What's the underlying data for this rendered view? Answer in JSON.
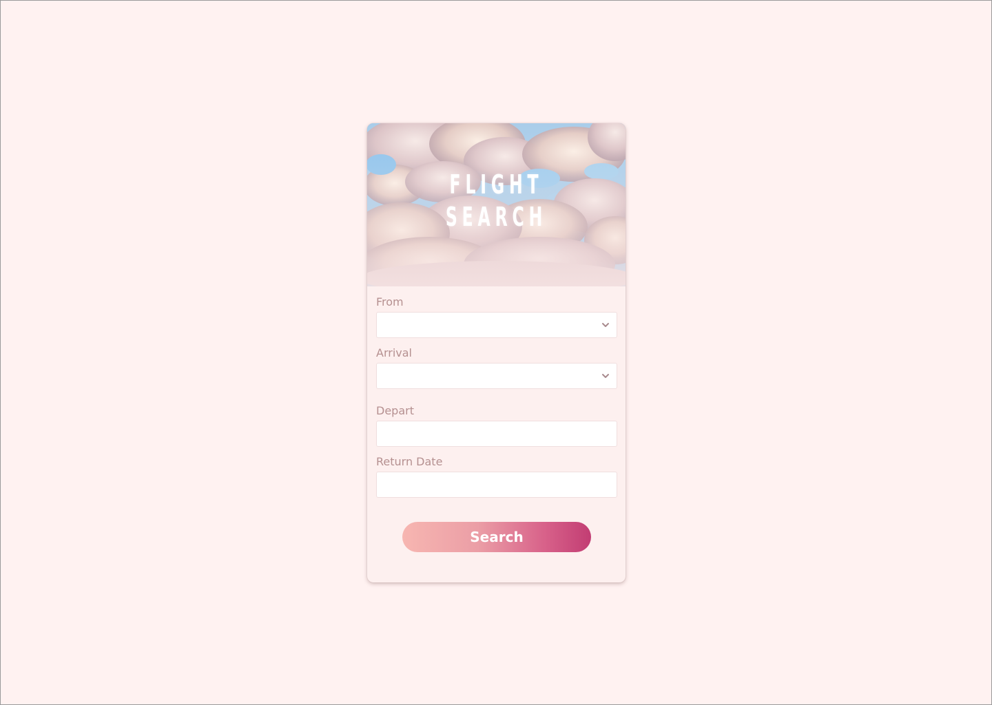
{
  "hero": {
    "title_line1": "FLIGHT",
    "title_line2": "SEARCH"
  },
  "form": {
    "from": {
      "label": "From",
      "value": ""
    },
    "arrival": {
      "label": "Arrival",
      "value": ""
    },
    "depart": {
      "label": "Depart",
      "value": ""
    },
    "return_date": {
      "label": "Return Date",
      "value": ""
    }
  },
  "search_button": {
    "label": "Search"
  },
  "icons": {
    "dropdown": "chevron-down-icon"
  },
  "colors": {
    "page_background": "#fff2f1",
    "card_background": "#fdf0ef",
    "label": "#b59090",
    "button_gradient_start": "#f7b6b1",
    "button_gradient_end": "#c23d73",
    "sky": "#9ec9ea"
  }
}
